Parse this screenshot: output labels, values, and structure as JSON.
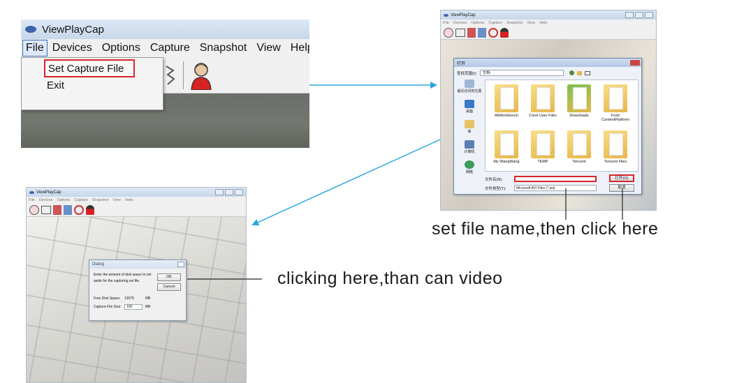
{
  "app_title": "ViewPlayCap",
  "menu": [
    "File",
    "Devices",
    "Options",
    "Capture",
    "Snapshot",
    "View",
    "Help"
  ],
  "file_menu": {
    "items": [
      "Set Capture File",
      "Exit"
    ]
  },
  "open_dialog": {
    "title": "打开",
    "look_in_label": "查找范围(I):",
    "look_in_value": "文档",
    "places": [
      "最近访问的位置",
      "桌面",
      "库",
      "计算机",
      "网络"
    ],
    "folders": [
      "AliWorkbench",
      "Corel User Files",
      "Downloads",
      "Foxit ContentPlatform",
      "My WangWang",
      "TEMP",
      "Tencent",
      "Tencent Files"
    ],
    "filename_label": "文件名(N):",
    "filetype_label": "文件类型(T):",
    "filetype_value": "Microsoft AVI Files (*.avi)",
    "open_button": "打开(O)",
    "cancel_button": "取消"
  },
  "alloc_dialog": {
    "title": "Dialog",
    "message": "Enter the amount of disk space to set aside for the capturing avi file.",
    "ok_button": "OK",
    "cancel_button": "Cancel",
    "free_space_label": "Free Disk Space:",
    "free_space_value": "12075",
    "free_space_unit": "MB",
    "capture_size_label": "Capture File Size:",
    "capture_size_value": "100",
    "capture_size_unit": "MB"
  },
  "annotations": {
    "set_file": "set file name,then click here",
    "click_ok": "clicking here,than can video"
  },
  "colors": {
    "highlight": "#d9242b",
    "arrow": "#2aa7df"
  }
}
